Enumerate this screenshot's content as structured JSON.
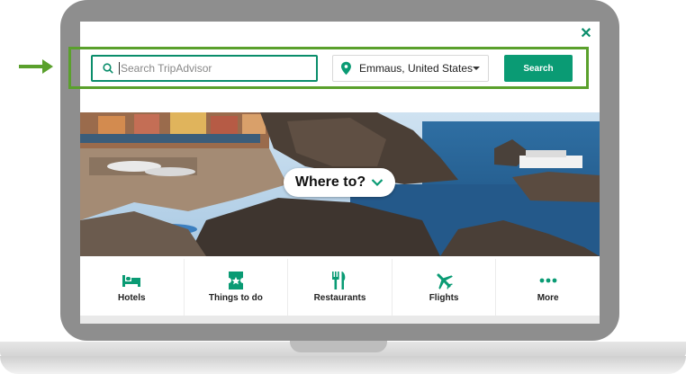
{
  "search": {
    "placeholder": "Search TripAdvisor",
    "button_label": "Search"
  },
  "location": {
    "value": "Emmaus, United States"
  },
  "hero": {
    "cta": "Where to?"
  },
  "categories": [
    {
      "label": "Hotels",
      "icon": "bed-icon"
    },
    {
      "label": "Things to do",
      "icon": "ticket-icon"
    },
    {
      "label": "Restaurants",
      "icon": "fork-knife-icon"
    },
    {
      "label": "Flights",
      "icon": "plane-icon"
    },
    {
      "label": "More",
      "icon": "more-dots-icon"
    }
  ],
  "colors": {
    "brand_green": "#0a9b74",
    "highlight_green": "#5aa02c",
    "frame_gray": "#8e8e8e"
  }
}
